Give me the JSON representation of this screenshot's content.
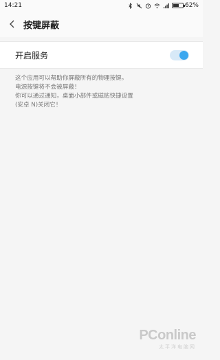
{
  "status_bar": {
    "time": "14:21",
    "battery_text": "62%",
    "battery_level": 62,
    "icons": [
      "bluetooth-icon",
      "mute-icon",
      "alarm-icon",
      "wifi-icon",
      "signal-icon",
      "battery-icon"
    ]
  },
  "header": {
    "back_icon": "chevron-left-icon",
    "title": "按键屏蔽"
  },
  "settings": {
    "service_label": "开启服务",
    "service_enabled": true,
    "accent_color": "#3ba7ef"
  },
  "description": {
    "lines": [
      "这个应用可以帮助你屏蔽所有的物理按键。",
      "电源按键将不会被屏蔽！",
      "你可以通过通知，桌面小部件或磁贴快捷设置",
      "(安卓 N)关闭它！"
    ]
  },
  "watermark": {
    "brand": "PConline",
    "sub": "太平洋电脑网"
  }
}
